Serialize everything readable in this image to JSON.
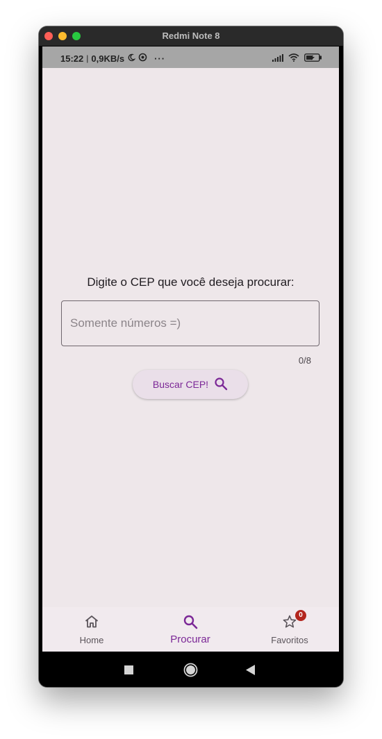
{
  "window": {
    "title": "Redmi Note 8"
  },
  "status_bar": {
    "time": "15:22",
    "separator": "|",
    "speed": "0,9KB/s",
    "more": "···"
  },
  "main": {
    "prompt": "Digite o CEP que você deseja procurar:",
    "cep_input": {
      "placeholder": "Somente números =)",
      "value": ""
    },
    "counter": "0/8",
    "search_button_label": "Buscar CEP!"
  },
  "bottom_nav": {
    "items": [
      {
        "label": "Home",
        "icon": "home-icon"
      },
      {
        "label": "Procurar",
        "icon": "search-icon",
        "active": true
      },
      {
        "label": "Favoritos",
        "icon": "star-icon",
        "badge": "0"
      }
    ]
  },
  "colors": {
    "accent": "#7b2796",
    "background": "#eee7ea",
    "badge": "#b3261e"
  }
}
